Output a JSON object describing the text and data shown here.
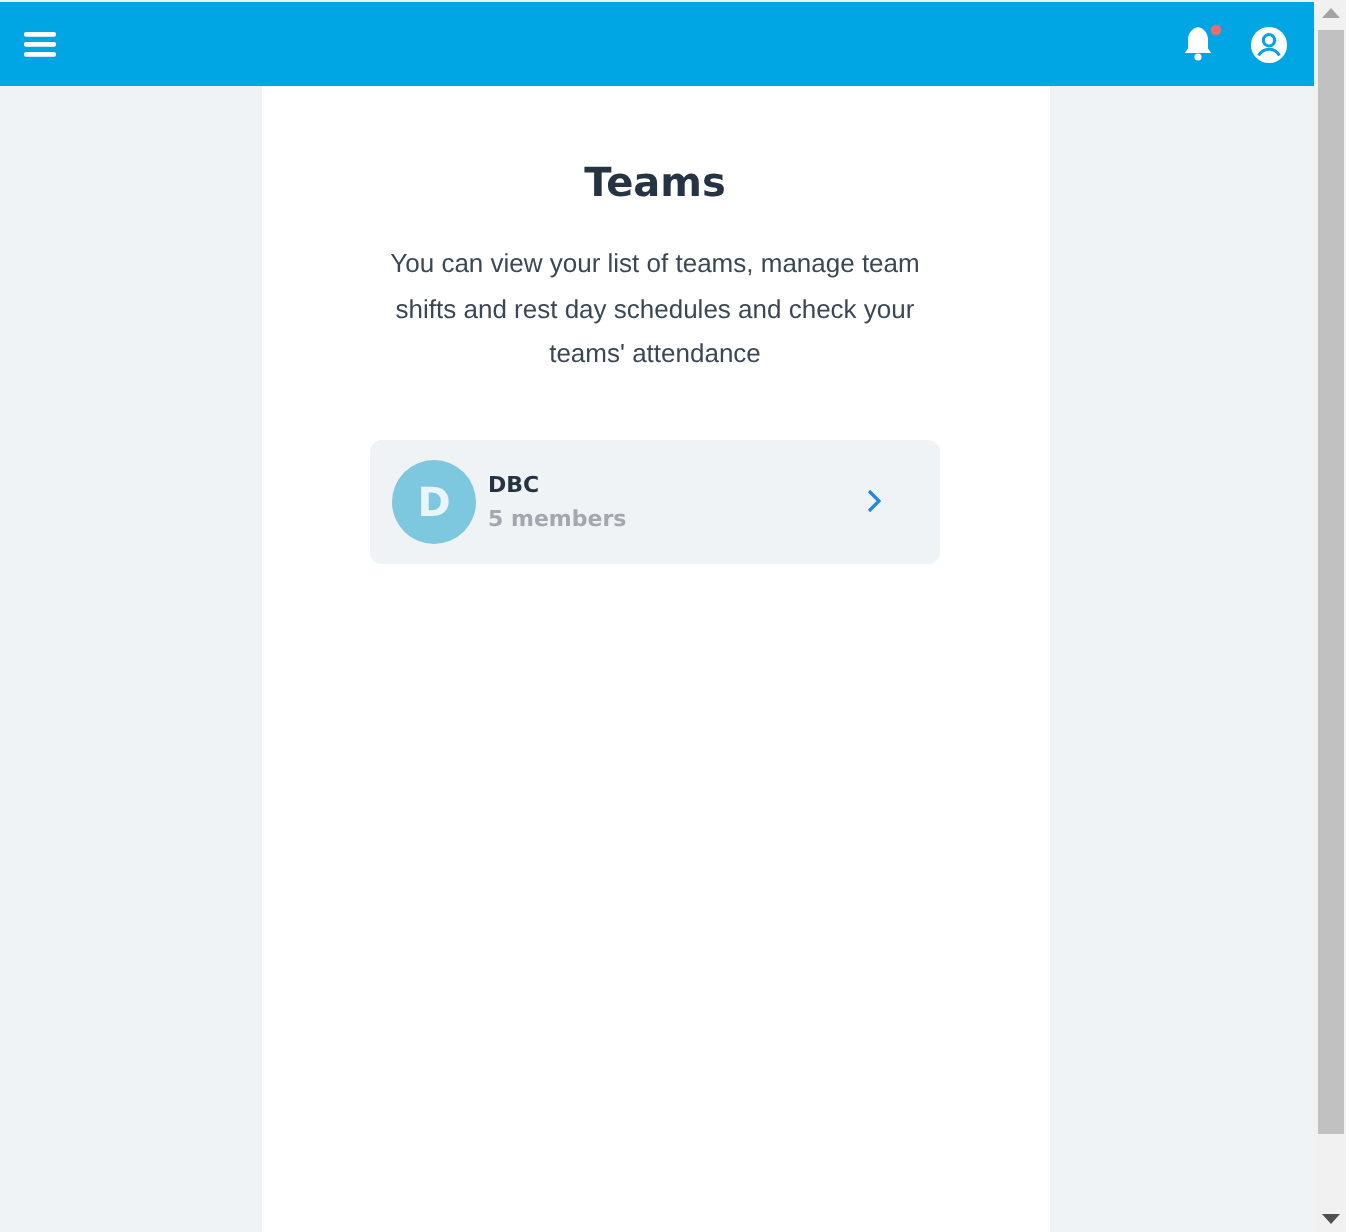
{
  "header": {
    "has_notification": true
  },
  "page": {
    "title": "Teams",
    "description": "You can view your list of teams, manage team shifts and rest day schedules and check your teams' attendance"
  },
  "teams": [
    {
      "initial": "D",
      "name": "DBC",
      "members": "5 members"
    }
  ]
}
